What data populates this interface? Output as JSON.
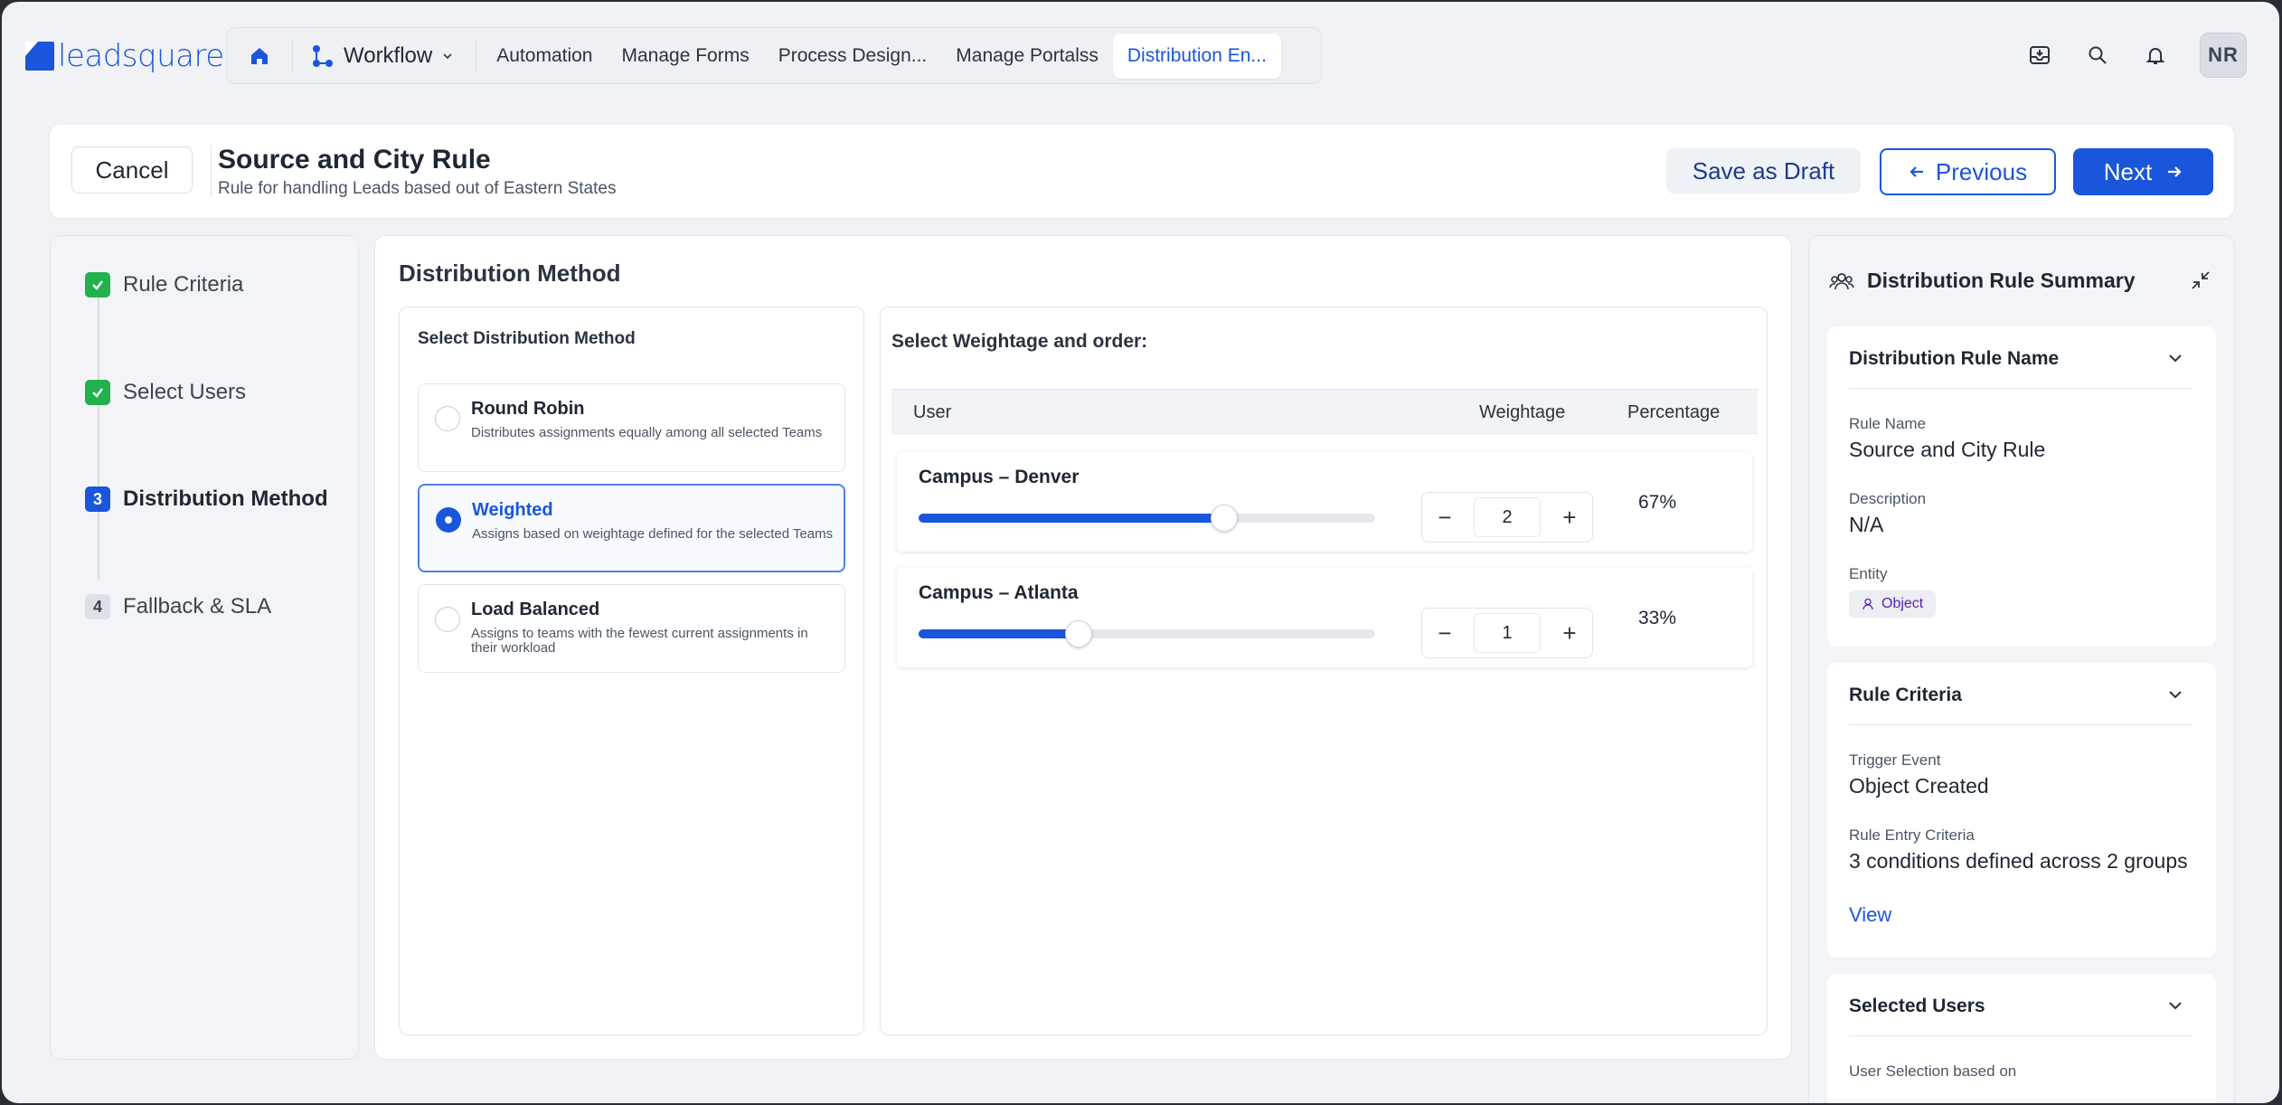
{
  "brand": {
    "name": "leadsquared"
  },
  "nav": {
    "home_icon": "home-icon",
    "workflow_label": "Workflow",
    "tabs": [
      {
        "label": "Automation",
        "active": false
      },
      {
        "label": "Manage Forms",
        "active": false
      },
      {
        "label": "Process Design...",
        "active": false
      },
      {
        "label": "Manage Portalss",
        "active": false
      },
      {
        "label": "Distribution En...",
        "active": true
      }
    ]
  },
  "top_icons": [
    "inbox-icon",
    "search-icon",
    "bell-icon"
  ],
  "user": {
    "initials": "NR"
  },
  "header": {
    "cancel_label": "Cancel",
    "title": "Source and City Rule",
    "description": "Rule for handling Leads based out of Eastern States",
    "save_draft_label": "Save as Draft",
    "previous_label": "Previous",
    "next_label": "Next"
  },
  "steps": [
    {
      "number": "1",
      "label": "Rule Criteria",
      "state": "done"
    },
    {
      "number": "2",
      "label": "Select Users",
      "state": "done"
    },
    {
      "number": "3",
      "label": "Distribution Method",
      "state": "current"
    },
    {
      "number": "4",
      "label": "Fallback & SLA",
      "state": "todo"
    }
  ],
  "main": {
    "title": "Distribution Method",
    "method_panel_title": "Select Distribution Method",
    "methods": [
      {
        "title": "Round Robin",
        "desc": "Distributes assignments equally among all selected Teams",
        "selected": false
      },
      {
        "title": "Weighted",
        "desc": "Assigns based on weightage defined for the selected Teams",
        "selected": true
      },
      {
        "title": "Load Balanced",
        "desc": "Assigns to teams with the fewest current assignments in their workload",
        "selected": false
      }
    ],
    "weight_panel_title": "Select Weightage and order:",
    "columns": {
      "user": "User",
      "weightage": "Weightage",
      "percentage": "Percentage"
    },
    "rows": [
      {
        "name": "Campus – Denver",
        "weight": "2",
        "percentage": "67%",
        "slider_fraction": 0.67
      },
      {
        "name": "Campus – Atlanta",
        "weight": "1",
        "percentage": "33%",
        "slider_fraction": 0.35
      }
    ]
  },
  "summary": {
    "title": "Distribution Rule Summary",
    "rule_name_section": {
      "heading": "Distribution Rule Name",
      "rule_name_label": "Rule Name",
      "rule_name_value": "Source and City Rule",
      "description_label": "Description",
      "description_value": "N/A",
      "entity_label": "Entity",
      "entity_value": "Object"
    },
    "criteria_section": {
      "heading": "Rule Criteria",
      "trigger_label": "Trigger Event",
      "trigger_value": "Object Created",
      "entry_label": "Rule Entry Criteria",
      "entry_value": "3 conditions defined across 2 groups",
      "view_label": "View"
    },
    "users_section": {
      "heading": "Selected Users",
      "selection_label": "User Selection based on"
    }
  },
  "colors": {
    "accent": "#1a56db",
    "success": "#22b14c",
    "background": "#f0f2f6"
  }
}
